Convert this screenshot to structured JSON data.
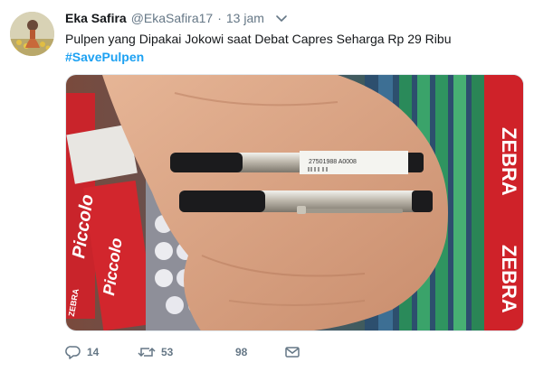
{
  "tweet": {
    "display_name": "Eka Safira",
    "handle": "@EkaSafira17",
    "separator": "·",
    "time": "13 jam",
    "text": "Pulpen yang Dipakai Jokowi saat Debat Capres Seharga Rp 29 Ribu",
    "hashtag": "#SavePulpen",
    "photo_text": {
      "brand_left": "ZEBRA",
      "brand_right": "ZEBRA",
      "product": "Piccolo",
      "barcode_label": "27501988 A0008"
    },
    "actions": {
      "replies": "14",
      "retweets": "53",
      "likes": "98"
    }
  },
  "colors": {
    "accent": "#1da1f2",
    "secondary_text": "#657786",
    "primary_text": "#14171a"
  },
  "icons": [
    "caret-down-icon",
    "reply-icon",
    "retweet-icon",
    "like-icon",
    "message-icon"
  ]
}
